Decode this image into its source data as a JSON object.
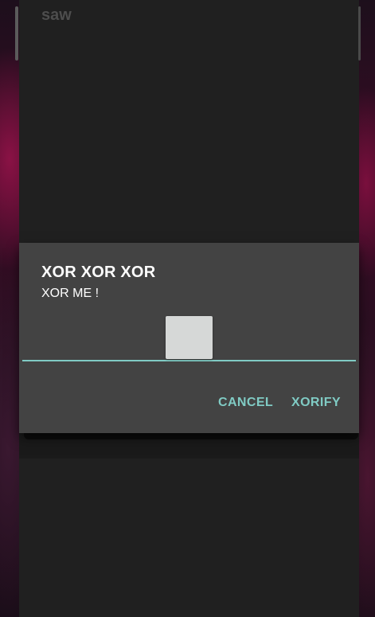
{
  "background_app": {
    "title": "saw"
  },
  "dialog": {
    "title": "XOR XOR XOR",
    "message": "XOR ME !",
    "input": {
      "value": "",
      "placeholder": ""
    },
    "buttons": {
      "cancel_label": "CANCEL",
      "confirm_label": "XORIFY"
    }
  },
  "colors": {
    "accent": "#80cbc4",
    "dialog_bg": "#434343",
    "app_bg": "#202020"
  }
}
